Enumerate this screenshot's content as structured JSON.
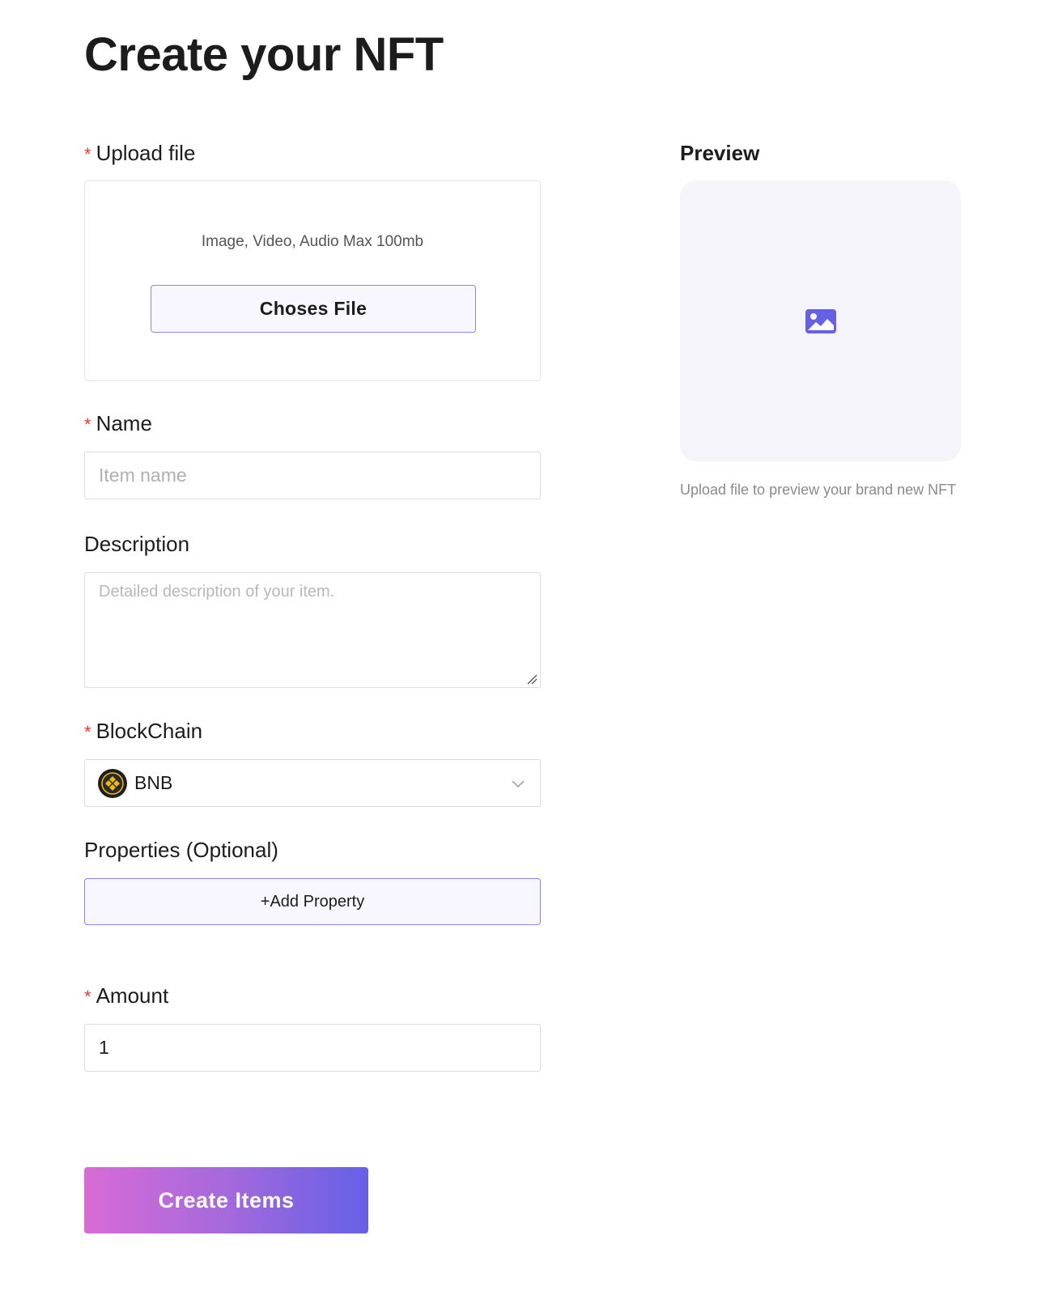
{
  "page": {
    "title": "Create your NFT"
  },
  "upload": {
    "label": "Upload file",
    "required_mark": "*",
    "hint": "Image, Video, Audio Max 100mb",
    "button_label": "Choses File"
  },
  "name": {
    "label": "Name",
    "required_mark": "*",
    "placeholder": "Item name",
    "value": ""
  },
  "description": {
    "label": "Description",
    "placeholder": "Detailed description of your item.",
    "value": ""
  },
  "blockchain": {
    "label": "BlockChain",
    "required_mark": "*",
    "selected": "BNB",
    "icon": "bnb-coin-icon"
  },
  "properties": {
    "label": "Properties (Optional)",
    "add_button_label": "+Add Property"
  },
  "amount": {
    "label": "Amount",
    "required_mark": "*",
    "value": "1"
  },
  "submit": {
    "label": "Create Items"
  },
  "preview": {
    "label": "Preview",
    "caption": "Upload file to preview your brand new NFT",
    "icon": "image-placeholder-icon"
  },
  "colors": {
    "accent": "#6560e6",
    "accent_border": "#8b87ea",
    "gradient_start": "#d86bd6",
    "gradient_end": "#6560e6",
    "required": "#e53935",
    "bnb_gold": "#f0b90b"
  }
}
